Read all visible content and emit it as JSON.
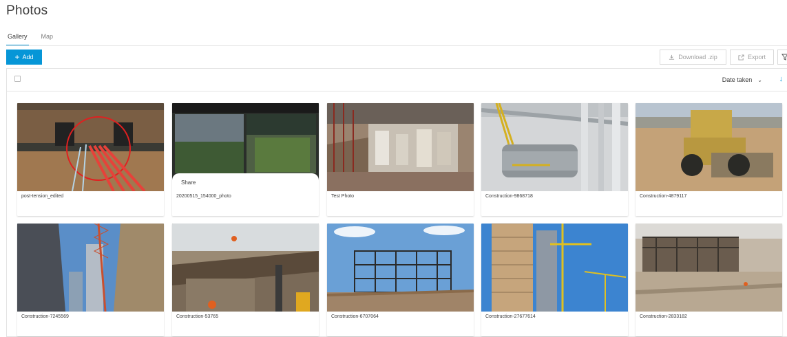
{
  "page": {
    "title": "Photos"
  },
  "tabs": [
    {
      "label": "Gallery",
      "active": true
    },
    {
      "label": "Map",
      "active": false
    }
  ],
  "toolbar": {
    "add_label": "Add",
    "download_label": "Download .zip",
    "export_label": "Export"
  },
  "grid_header": {
    "sort_label": "Date taken",
    "sort_direction_icon": "arrow-down-icon"
  },
  "photos": [
    {
      "caption": "post-tension_edited"
    },
    {
      "caption": "20200515_154000_photo",
      "overlay": "Share"
    },
    {
      "caption": "Test Photo"
    },
    {
      "caption": "Construction-9868718"
    },
    {
      "caption": "Construction-4879117"
    },
    {
      "caption": "Construction-7245569"
    },
    {
      "caption": "Construction-53765"
    },
    {
      "caption": "Construction-6707064"
    },
    {
      "caption": "Construction-27677614"
    },
    {
      "caption": "Construction-2833182"
    }
  ],
  "colors": {
    "accent": "#0696d7",
    "border": "#e3e3e3"
  }
}
